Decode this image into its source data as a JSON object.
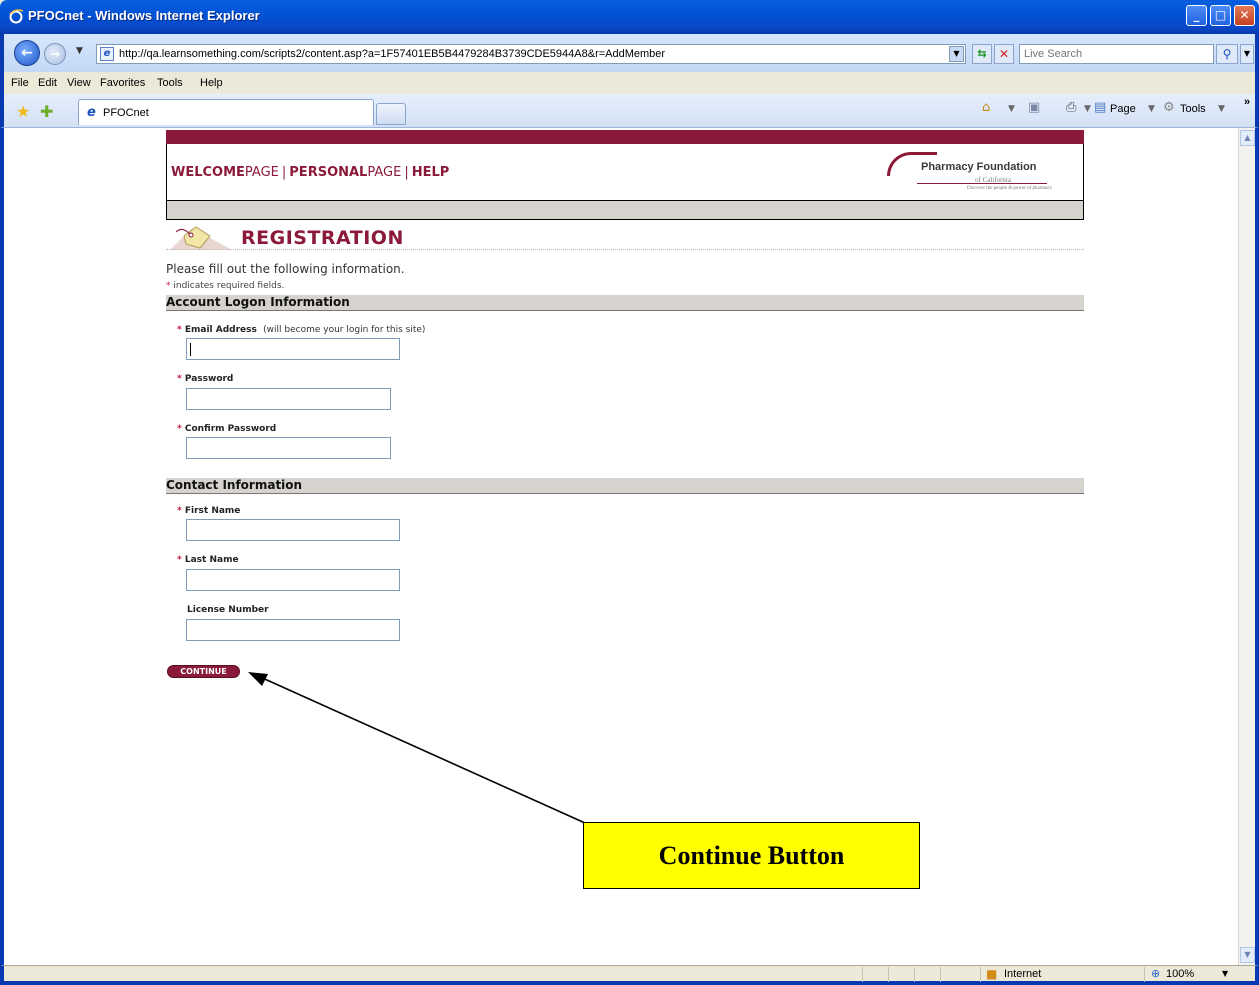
{
  "window": {
    "title": "PFOCnet - Windows Internet Explorer"
  },
  "browser": {
    "url": "http://qa.learnsomething.com/scripts2/content.asp?a=1F57401EB5B4479284B3739CDE5944A8&r=AddMember",
    "search_placeholder": "Live Search",
    "menu": [
      "File",
      "Edit",
      "View",
      "Favorites",
      "Tools",
      "Help"
    ],
    "tab_label": "PFOCnet",
    "commands": {
      "page": "Page",
      "tools": "Tools"
    }
  },
  "site": {
    "nav": {
      "welcome_bold": "WELCOME",
      "welcome_thin": "PAGE",
      "personal_bold": "PERSONAL",
      "personal_thin": "PAGE",
      "help": "HELP",
      "separator": "|"
    },
    "logo": {
      "name": "Pharmacy Foundation",
      "sub": "of California",
      "tagline": "Discover the people & power of pharmacy"
    }
  },
  "form": {
    "heading": "REGISTRATION",
    "intro": "Please fill out the following information.",
    "required_marker": "*",
    "required_note": " indicates required fields.",
    "sections": {
      "account": "Account Logon Information",
      "contact": "Contact Information"
    },
    "fields": {
      "email_label": "Email Address",
      "email_note": "(will become your login for this site)",
      "password_label": "Password",
      "confirm_label": "Confirm Password",
      "first_label": "First Name",
      "last_label": "Last Name",
      "license_label": "License Number"
    },
    "continue_label": "CONTINUE"
  },
  "annotation": {
    "callout": "Continue Button"
  },
  "status": {
    "zone": "Internet",
    "zoom": "100%"
  },
  "colors": {
    "brand": "#8b1a3a",
    "callout": "#ffff00"
  }
}
